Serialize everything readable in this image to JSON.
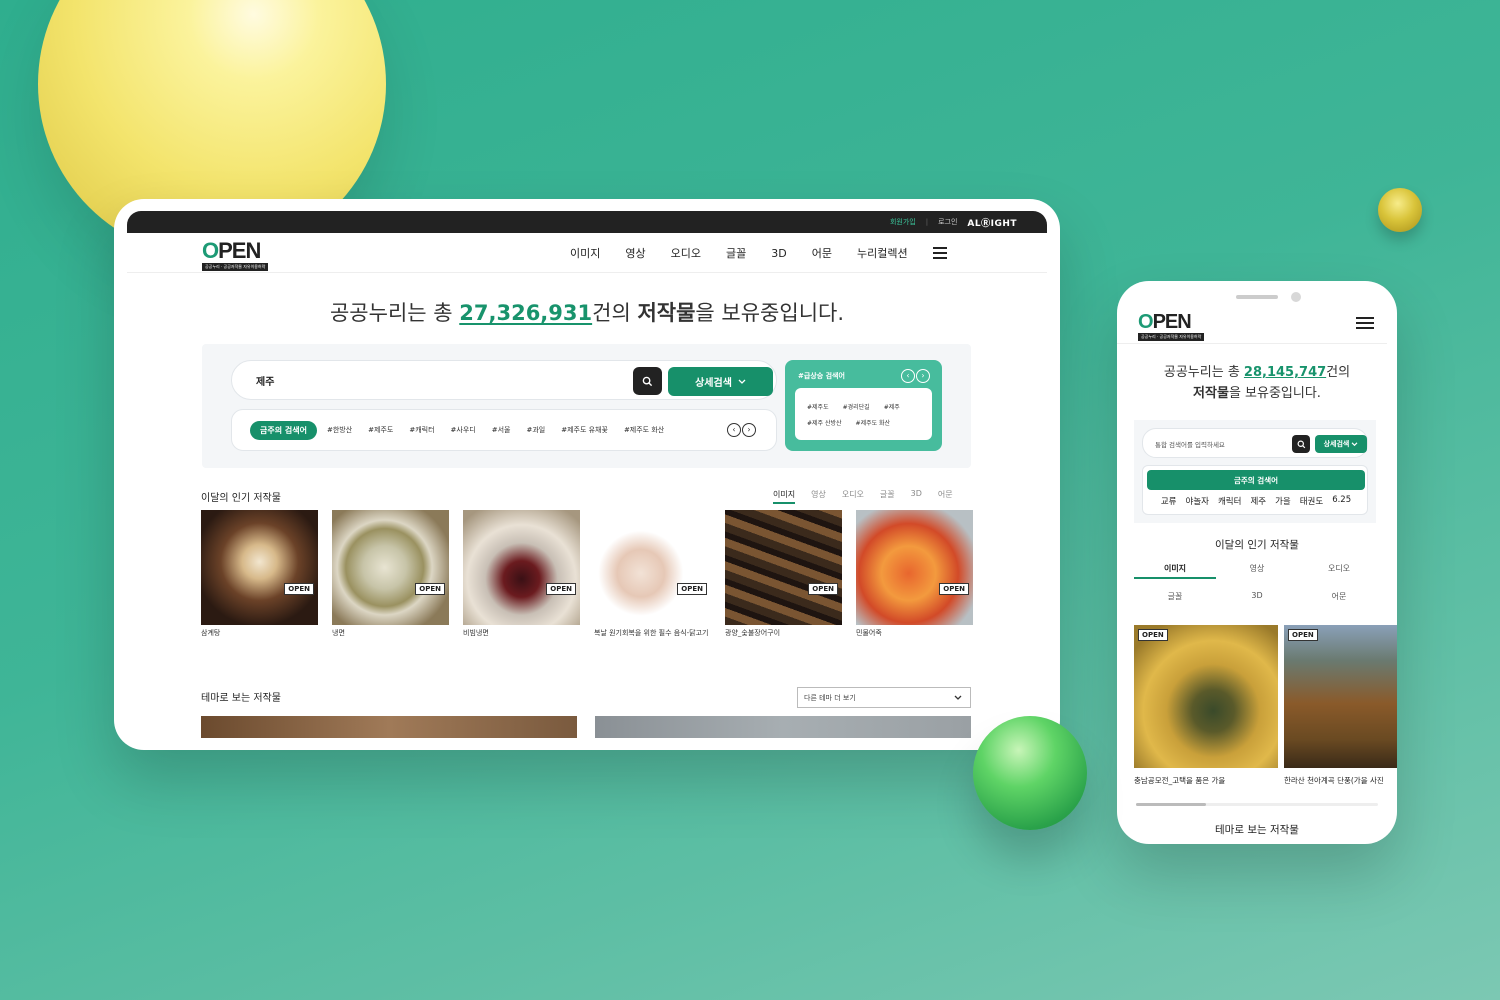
{
  "tablet": {
    "topbar": {
      "join": "회원가입",
      "login": "로그인",
      "brand": "ALⓇIGHT"
    },
    "logo": {
      "text_o": "O",
      "text_rest": "PEN",
      "subtitle": "공공누리 · 공공저작물 자유이용허락"
    },
    "nav": [
      "이미지",
      "영상",
      "오디오",
      "글꼴",
      "3D",
      "어문",
      "누리컬렉션"
    ],
    "hero": {
      "prefix": "공공누리는 총 ",
      "count": "27,326,931",
      "mid": "건의 ",
      "bold": "저작물",
      "suffix": "을 보유중입니다."
    },
    "search": {
      "value": "제주",
      "detail_button": "상세검색"
    },
    "keywords": {
      "badge": "금주의 검색어",
      "tags": [
        "#한방산",
        "#제주도",
        "#캐릭터",
        "#사우디",
        "#서울",
        "#과일",
        "#제주도 유채꽃",
        "#제주도 화산"
      ]
    },
    "rising": {
      "title": "#급상승 검색어",
      "tags": [
        "#제주도",
        "#경리단길",
        "#제주",
        "#제주 산방산",
        "#제주도 화산"
      ]
    },
    "popular": {
      "title": "이달의 인기 저작물",
      "tabs": [
        "이미지",
        "영상",
        "오디오",
        "글꼴",
        "3D",
        "어문"
      ],
      "items": [
        {
          "caption": "삼계탕"
        },
        {
          "caption": "냉면"
        },
        {
          "caption": "비빔냉면"
        },
        {
          "caption": "복날 원기회복을 위한 필수 음식-닭고기"
        },
        {
          "caption": "광양_숯불장어구이"
        },
        {
          "caption": "민물어죽"
        }
      ]
    },
    "theme": {
      "title": "테마로 보는 저작물",
      "select": "다른 테마 더 보기"
    }
  },
  "phone": {
    "hero": {
      "prefix": "공공누리는 총 ",
      "count": "28,145,747",
      "mid": "건의",
      "bold": "저작물",
      "suffix": "을 보유중입니다."
    },
    "search": {
      "placeholder": "통합 검색어를 입력하세요",
      "detail_button": "상세검색"
    },
    "keywords": {
      "badge": "금주의 검색어",
      "tags": [
        "교류",
        "야놀자",
        "캐릭터",
        "제주",
        "가을",
        "태권도",
        "6.25"
      ]
    },
    "popular": {
      "title": "이달의 인기 저작물",
      "tabs": [
        "이미지",
        "영상",
        "오디오",
        "글꼴",
        "3D",
        "어문"
      ],
      "items": [
        {
          "caption": "충남공모전_고택을 품은 가을"
        },
        {
          "caption": "한라산 천아계곡 단풍(가을 사진"
        }
      ]
    },
    "theme": {
      "title": "테마로 보는 저작물"
    }
  },
  "badge_text": "OPEN",
  "colors": {
    "accent": "#17906a",
    "background": "#3fb597",
    "dark": "#222222"
  },
  "icons": [
    "search-icon",
    "chevron-down-icon",
    "chevron-left-icon",
    "chevron-right-icon",
    "hamburger-menu-icon"
  ]
}
